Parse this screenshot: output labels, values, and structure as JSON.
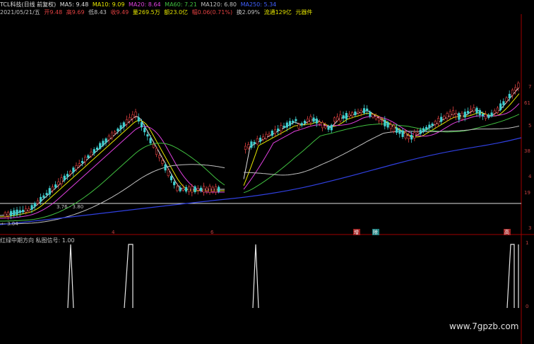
{
  "header": {
    "stock_name": "TCL科技(日线 前复权)",
    "ma_items": [
      {
        "text": "MA5: 9.48",
        "color": "#e0e0e0"
      },
      {
        "text": "MA10: 9.09",
        "color": "#e8e800"
      },
      {
        "text": "MA20: 8.64",
        "color": "#e040e0"
      },
      {
        "text": "MA60: 7.21",
        "color": "#40c040"
      },
      {
        "text": "MA120: 6.80",
        "color": "#c0c0c0"
      },
      {
        "text": "MA250: 5.34",
        "color": "#4060ff"
      }
    ],
    "quote_date": "2021/05/21/五",
    "quote_items": [
      {
        "text": "开9.48",
        "color": "#e04040"
      },
      {
        "text": "高9.69",
        "color": "#e04040"
      },
      {
        "text": "低8.43",
        "color": "#c0c0c0"
      },
      {
        "text": "收9.49",
        "color": "#e04040"
      },
      {
        "text": "量269.5万",
        "color": "#e0e000"
      },
      {
        "text": "额23.0亿",
        "color": "#e0e000"
      },
      {
        "text": "幅0.06(0.71%)",
        "color": "#e04040"
      },
      {
        "text": "换2.09%",
        "color": "#c0c0c0"
      },
      {
        "text": "流通129亿",
        "color": "#e0e000"
      },
      {
        "text": "元器件",
        "color": "#e0e000"
      }
    ]
  },
  "right_axis_labels": [
    "7",
    "61",
    "5",
    "38",
    "4",
    "19",
    "3"
  ],
  "price_labels": {
    "low_label": "3.76 - 3.80",
    "left_label": "← 3.04"
  },
  "event_markers": [
    "4",
    "6",
    "增",
    "除",
    "高"
  ],
  "indicator": {
    "title": "红绿中期方向 私图信号: 1.00",
    "axis_labels": [
      "1",
      "0"
    ]
  },
  "watermark": "www.7gpzb.com",
  "colors": {
    "background": "#000000",
    "up": "#e04040",
    "down": "#40d0d0",
    "ma5": "#e0e0e0",
    "ma10": "#e8e800",
    "ma20": "#e040e0",
    "ma60": "#40c040",
    "ma120": "#c0c0c0",
    "ma250": "#3040e0",
    "axis": "#a00000"
  }
}
